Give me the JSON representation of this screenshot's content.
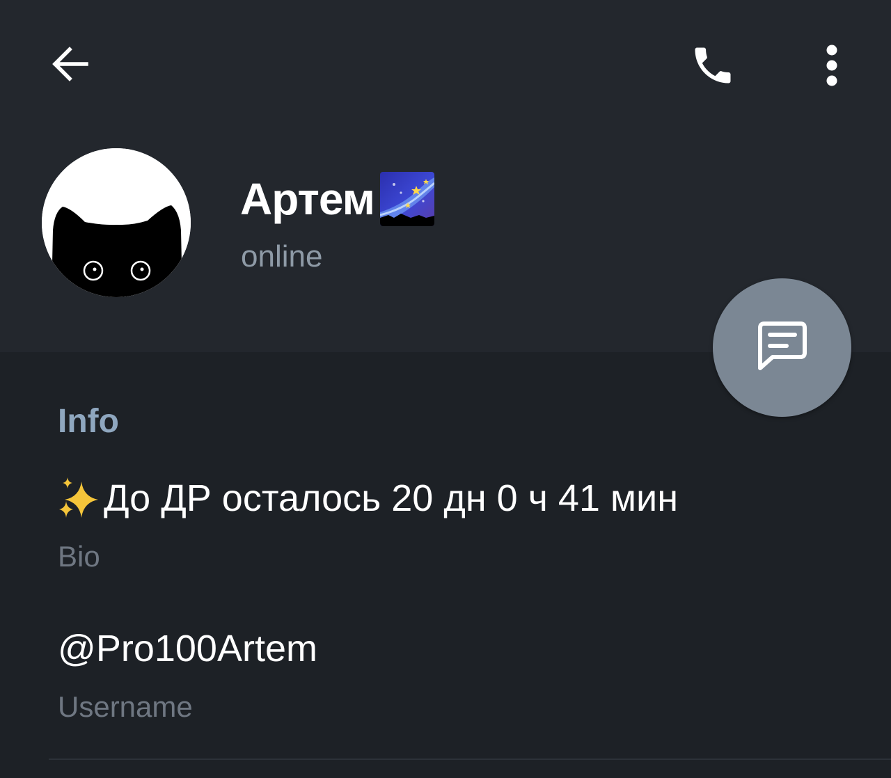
{
  "toolbar": {
    "back_icon": "arrow-left-icon",
    "call_icon": "phone-icon",
    "more_icon": "more-vertical-icon"
  },
  "profile": {
    "name": "Артем",
    "name_emoji": "milky-way-emoji",
    "status": "online"
  },
  "fab": {
    "icon": "message-icon"
  },
  "info": {
    "title": "Info",
    "bio": {
      "emoji": "sparkles-emoji",
      "value": "До ДР осталось 20 дн 0 ч 41 мин",
      "label": "Bio"
    },
    "username": {
      "value": "@Pro100Artem",
      "label": "Username"
    }
  },
  "colors": {
    "header_bg": "#23272d",
    "page_bg": "#1d2126",
    "accent": "#8fa7bf",
    "fab_bg": "#7b8794",
    "secondary_text": "#6f7782"
  }
}
